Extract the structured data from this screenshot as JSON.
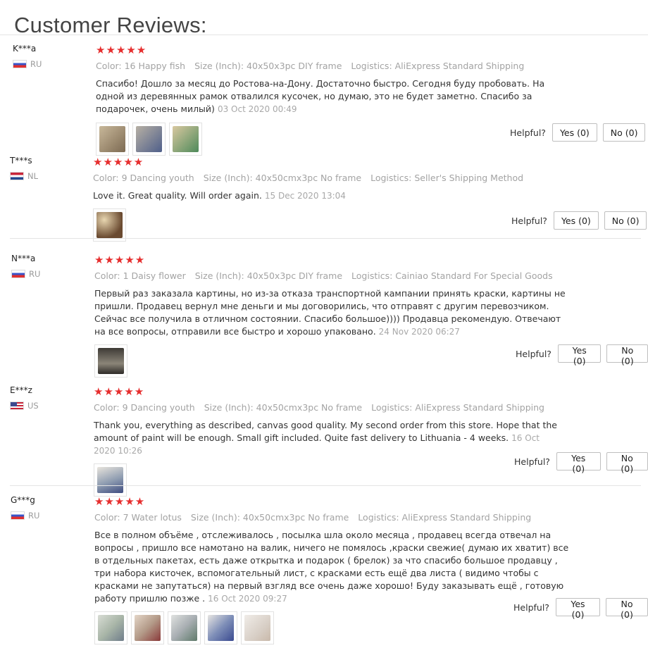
{
  "page": {
    "title": "Customer Reviews:"
  },
  "helpful_label": "Helpful?",
  "reviews": [
    {
      "user": "K***a",
      "country": "RU",
      "stars": "★★★★★",
      "color": "Color: 16 Happy fish",
      "size": "Size (Inch): 40x50x3pc DIY frame",
      "logistics": "Logistics: AliExpress Standard Shipping",
      "text": "Спасибо! Дошло за месяц до Ростова-на-Дону. Достаточно быстро. Сегодня буду пробовать. На одной из деревянных рамок отвалился кусочек, но думаю, это не будет заметно. Спасибо за подарочек, очень милый)",
      "date": "03 Oct 2020 00:49",
      "yes": "Yes (0)",
      "no": "No (0)",
      "thumbs": [
        "#9b8a72",
        "#8a93a8",
        "#6f9a78"
      ]
    },
    {
      "user": "T***s",
      "country": "NL",
      "stars": "★★★★★",
      "color": "Color: 9 Dancing youth",
      "size": "Size (Inch): 40x50cmx3pc No frame",
      "logistics": "Logistics: Seller's Shipping Method",
      "text": "Love it. Great quality. Will order again.",
      "date": "15 Dec 2020 13:04",
      "yes": "Yes (0)",
      "no": "No (0)",
      "thumbs": [
        "#6a4a30"
      ]
    },
    {
      "user": "N***a",
      "country": "RU",
      "stars": "★★★★★",
      "color": "Color: 1 Daisy flower",
      "size": "Size (Inch): 40x50x3pc DIY frame",
      "logistics": "Logistics: Cainiao Standard For Special Goods",
      "text": "Первый раз заказала картины, но из-за отказа транспортной кампании принять краски, картины не пришли. Продавец вернул мне деньги и мы договорились, что отправят с другим перевозчиком. Сейчас все получила в отличном состоянии. Спасибо большое)))) Продавца рекомендую. Отвечают на все вопросы, отправили все быстро и хорошо упаковано.",
      "date": "24 Nov 2020 06:27",
      "yes": "Yes (0)",
      "no": "No (0)",
      "thumbs": [
        "#5a5650"
      ]
    },
    {
      "user": "E***z",
      "country": "US",
      "stars": "★★★★★",
      "color": "Color: 9 Dancing youth",
      "size": "Size (Inch): 40x50cmx3pc No frame",
      "logistics": "Logistics: AliExpress Standard Shipping",
      "text": "Thank you, everything as described, canvas good quality. My second order from this store. Hope that the amount of paint will be enough. Small gift included. Quite fast delivery to Lithuania - 4 weeks.",
      "date": "16 Oct 2020 10:26",
      "yes": "Yes (0)",
      "no": "No (0)",
      "thumbs": [
        "#8d9bb0"
      ]
    },
    {
      "user": "G***g",
      "country": "RU",
      "stars": "★★★★★",
      "color": "Color: 7 Water lotus",
      "size": "Size (Inch): 40x50cmx3pc No frame",
      "logistics": "Logistics: AliExpress Standard Shipping",
      "text": "Все в полном объёме , отслеживалось , посылка шла около месяца , продавец всегда отвечал на вопросы , пришло все намотано на валик, ничего не помялось ,краски свежие( думаю их хватит) все в отдельных пакетах, есть даже открытка и подарок ( брелок) за что спасибо большое продавцу , три набора кисточек, вспомогательный лист, с красками есть ещё два листа ( видимо чтобы с красками не запутаться) на первый взгляд все очень даже хорошо! Буду заказывать ещё , готовую работу пришлю позже .",
      "date": "16 Oct 2020 09:27",
      "yes": "Yes (0)",
      "no": "No (0)",
      "thumbs": [
        "#a9b6a8",
        "#b39a88",
        "#a8aeb2",
        "#7f8fb8",
        "#d8cfc6"
      ]
    }
  ]
}
